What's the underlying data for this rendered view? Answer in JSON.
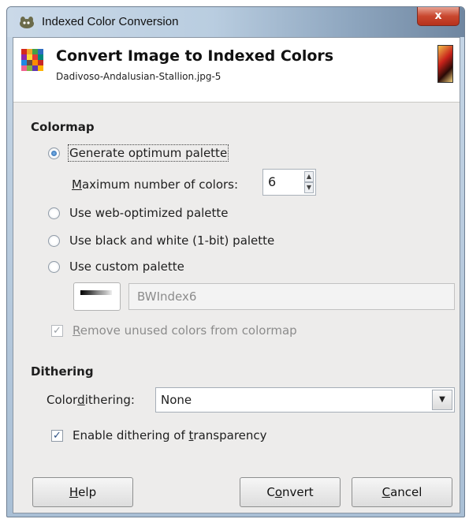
{
  "window": {
    "title": "Indexed Color Conversion",
    "close_label": "x"
  },
  "header": {
    "title": "Convert Image to Indexed Colors",
    "subtitle": "Dadivoso-Andalusian-Stallion.jpg-5"
  },
  "colormap": {
    "section_title": "Colormap",
    "generate_optimum": {
      "label": "Generate optimum palette",
      "selected": true
    },
    "max_colors": {
      "label_prefix": "M",
      "label_rest": "aximum number of colors:",
      "value": "6"
    },
    "web_optimized": {
      "label": "Use web-optimized palette",
      "selected": false
    },
    "black_white": {
      "label": "Use black and white (1-bit) palette",
      "selected": false
    },
    "custom": {
      "label": "Use custom palette",
      "selected": false,
      "palette_name": "BWIndex6"
    },
    "remove_unused": {
      "label_prefix": "R",
      "label_rest": "emove unused colors from colormap",
      "checked": true,
      "enabled": false
    }
  },
  "dithering": {
    "section_title": "Dithering",
    "color_dithering": {
      "label_pre": "Color ",
      "label_accel": "d",
      "label_post": "ithering:",
      "value": "None"
    },
    "transparency": {
      "label_pre": "Enable dithering of ",
      "label_accel": "t",
      "label_post": "ransparency",
      "checked": true
    }
  },
  "buttons": {
    "help": {
      "accel": "H",
      "rest": "elp"
    },
    "convert": {
      "pre": "C",
      "accel": "o",
      "rest": "nvert"
    },
    "cancel": {
      "accel": "C",
      "rest": "ancel"
    }
  },
  "icons": {
    "title": "gimp-wilber-icon",
    "header": "color-grid-icon",
    "close": "close-icon"
  }
}
